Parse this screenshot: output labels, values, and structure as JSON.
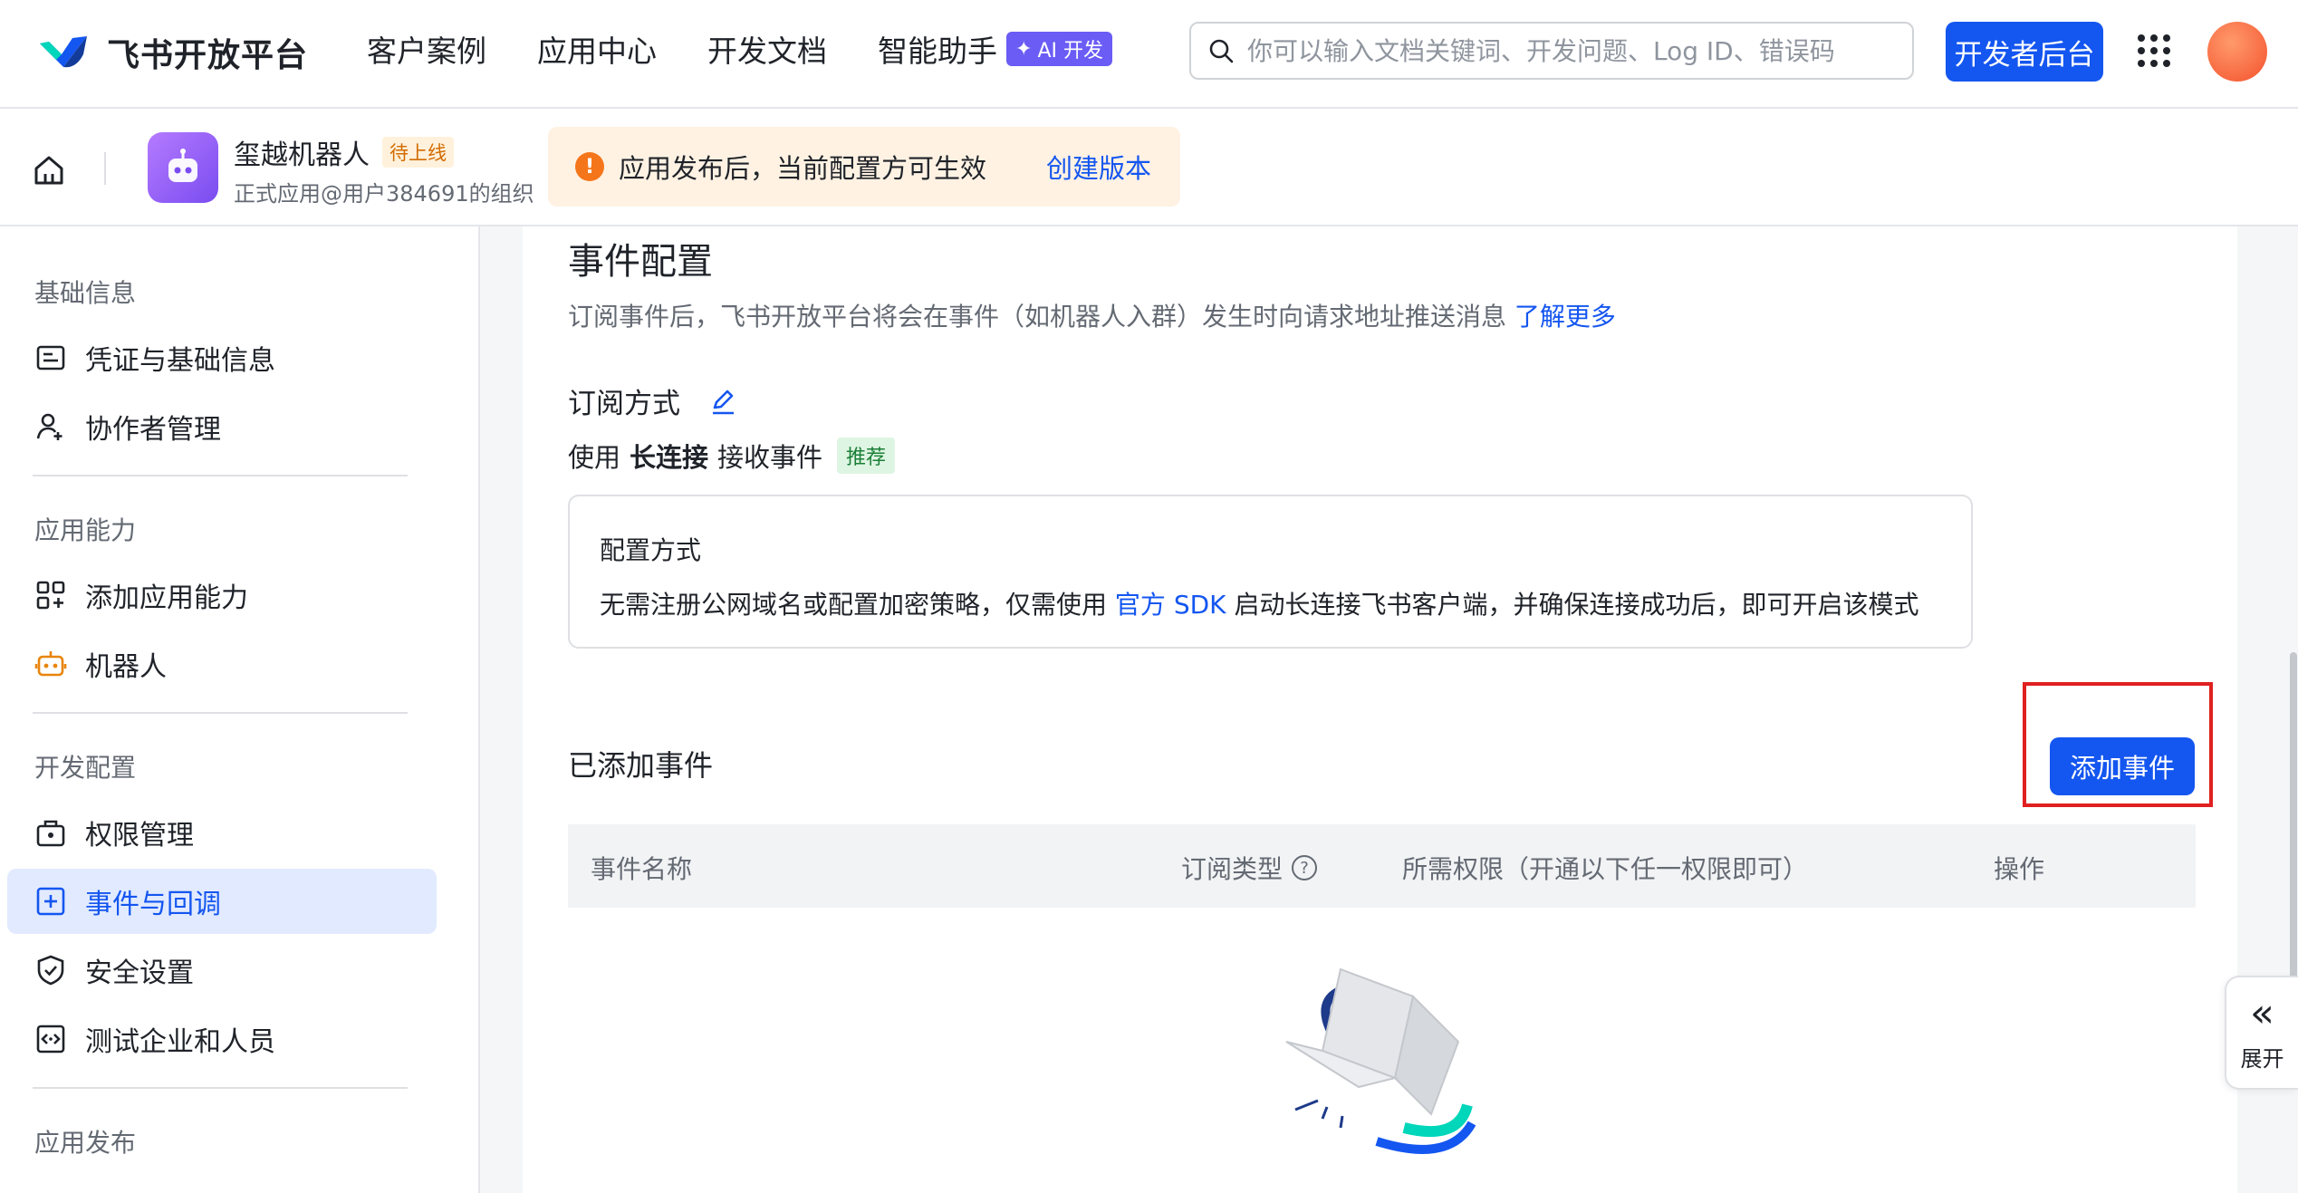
{
  "header": {
    "brand_name": "飞书开放平台",
    "nav": [
      "客户案例",
      "应用中心",
      "开发文档",
      "智能助手"
    ],
    "ai_badge": "AI 开发",
    "search_placeholder": "你可以输入文档关键词、开发问题、Log ID、错误码",
    "dev_console_label": "开发者后台",
    "icons": [
      "search-icon",
      "apps-grid-icon",
      "user-avatar"
    ]
  },
  "subheader": {
    "app_name": "玺越机器人",
    "status_badge": "待上线",
    "app_org": "正式应用@用户384691的组织",
    "notice_text": "应用发布后，当前配置方可生效",
    "notice_link": "创建版本"
  },
  "sidebar": {
    "groups": [
      {
        "label": "基础信息",
        "items": [
          {
            "label": "凭证与基础信息",
            "icon": "credential-icon"
          },
          {
            "label": "协作者管理",
            "icon": "collaborator-icon"
          }
        ]
      },
      {
        "label": "应用能力",
        "items": [
          {
            "label": "添加应用能力",
            "icon": "add-capability-icon"
          },
          {
            "label": "机器人",
            "icon": "robot-icon"
          }
        ]
      },
      {
        "label": "开发配置",
        "items": [
          {
            "label": "权限管理",
            "icon": "permission-icon"
          },
          {
            "label": "事件与回调",
            "icon": "event-icon",
            "active": true
          },
          {
            "label": "安全设置",
            "icon": "shield-icon"
          },
          {
            "label": "测试企业和人员",
            "icon": "test-icon"
          }
        ]
      },
      {
        "label": "应用发布",
        "items": []
      }
    ]
  },
  "main": {
    "title": "事件配置",
    "description": "订阅事件后，飞书开放平台将会在事件（如机器人入群）发生时向请求地址推送消息",
    "learn_more": "了解更多",
    "subscribe_title": "订阅方式",
    "use_prefix": "使用",
    "use_bold": "长连接",
    "use_suffix": "接收事件",
    "recommend_badge": "推荐",
    "config_title": "配置方式",
    "config_text_before": "无需注册公网域名或配置加密策略，仅需使用",
    "config_link": "官方 SDK",
    "config_text_after": "启动长连接飞书客户端，并确保连接成功后，即可开启该模式",
    "added_title": "已添加事件",
    "add_button": "添加事件",
    "table_headers": [
      "事件名称",
      "订阅类型",
      "所需权限（开通以下任一权限即可）",
      "操作"
    ]
  },
  "expand_label": "展开",
  "colors": {
    "accent": "#1456f0",
    "active_bg": "#e1eaff",
    "notice_bg": "#fff2e3",
    "highlight_border": "#e02020"
  }
}
